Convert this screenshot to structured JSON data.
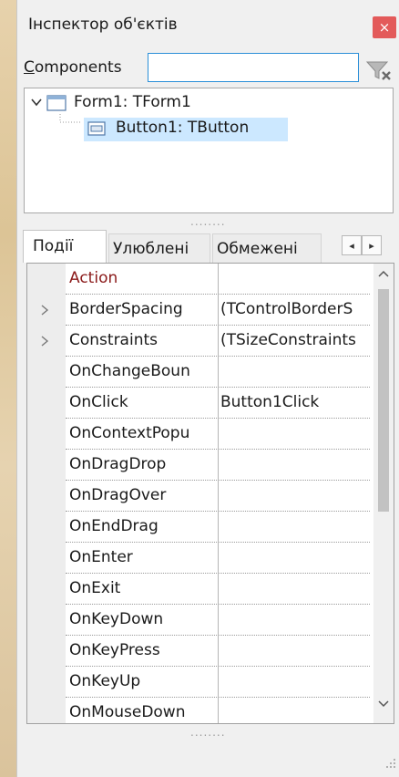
{
  "window": {
    "title": "Інспектор об'єктів",
    "close_glyph": "×"
  },
  "components": {
    "label_underlined": "C",
    "label_rest": "omponents",
    "search_value": "",
    "filter_icon": "filter-clear-icon"
  },
  "tree": {
    "nodes": [
      {
        "label": "Form1: TForm1",
        "icon": "form-icon",
        "expanded": true
      },
      {
        "label": "Button1: TButton",
        "icon": "button-component-icon",
        "selected": true
      }
    ]
  },
  "splitter_grip": "........",
  "tabs": [
    {
      "label": "Події",
      "active": true
    },
    {
      "label": "Улюблені",
      "active": false
    },
    {
      "label": "Обмежені",
      "active": false
    }
  ],
  "tab_scroll": {
    "left": "◂",
    "right": "▸"
  },
  "properties": [
    {
      "name": "Action",
      "value": "",
      "expandable": false,
      "highlight": true
    },
    {
      "name": "BorderSpacing",
      "value": "(TControlBorderS",
      "expandable": true,
      "highlight": false
    },
    {
      "name": "Constraints",
      "value": "(TSizeConstraints",
      "expandable": true,
      "highlight": false
    },
    {
      "name": "OnChangeBoun",
      "value": "",
      "expandable": false,
      "highlight": false
    },
    {
      "name": "OnClick",
      "value": "Button1Click",
      "expandable": false,
      "highlight": false
    },
    {
      "name": "OnContextPopu",
      "value": "",
      "expandable": false,
      "highlight": false
    },
    {
      "name": "OnDragDrop",
      "value": "",
      "expandable": false,
      "highlight": false
    },
    {
      "name": "OnDragOver",
      "value": "",
      "expandable": false,
      "highlight": false
    },
    {
      "name": "OnEndDrag",
      "value": "",
      "expandable": false,
      "highlight": false
    },
    {
      "name": "OnEnter",
      "value": "",
      "expandable": false,
      "highlight": false
    },
    {
      "name": "OnExit",
      "value": "",
      "expandable": false,
      "highlight": false
    },
    {
      "name": "OnKeyDown",
      "value": "",
      "expandable": false,
      "highlight": false
    },
    {
      "name": "OnKeyPress",
      "value": "",
      "expandable": false,
      "highlight": false
    },
    {
      "name": "OnKeyUp",
      "value": "",
      "expandable": false,
      "highlight": false
    },
    {
      "name": "OnMouseDown",
      "value": "",
      "expandable": false,
      "highlight": false
    }
  ],
  "colors": {
    "close": "#e35a5a",
    "selection": "#cce8ff",
    "highlight_text": "#8b1a1a",
    "input_border": "#2b8fd8"
  }
}
